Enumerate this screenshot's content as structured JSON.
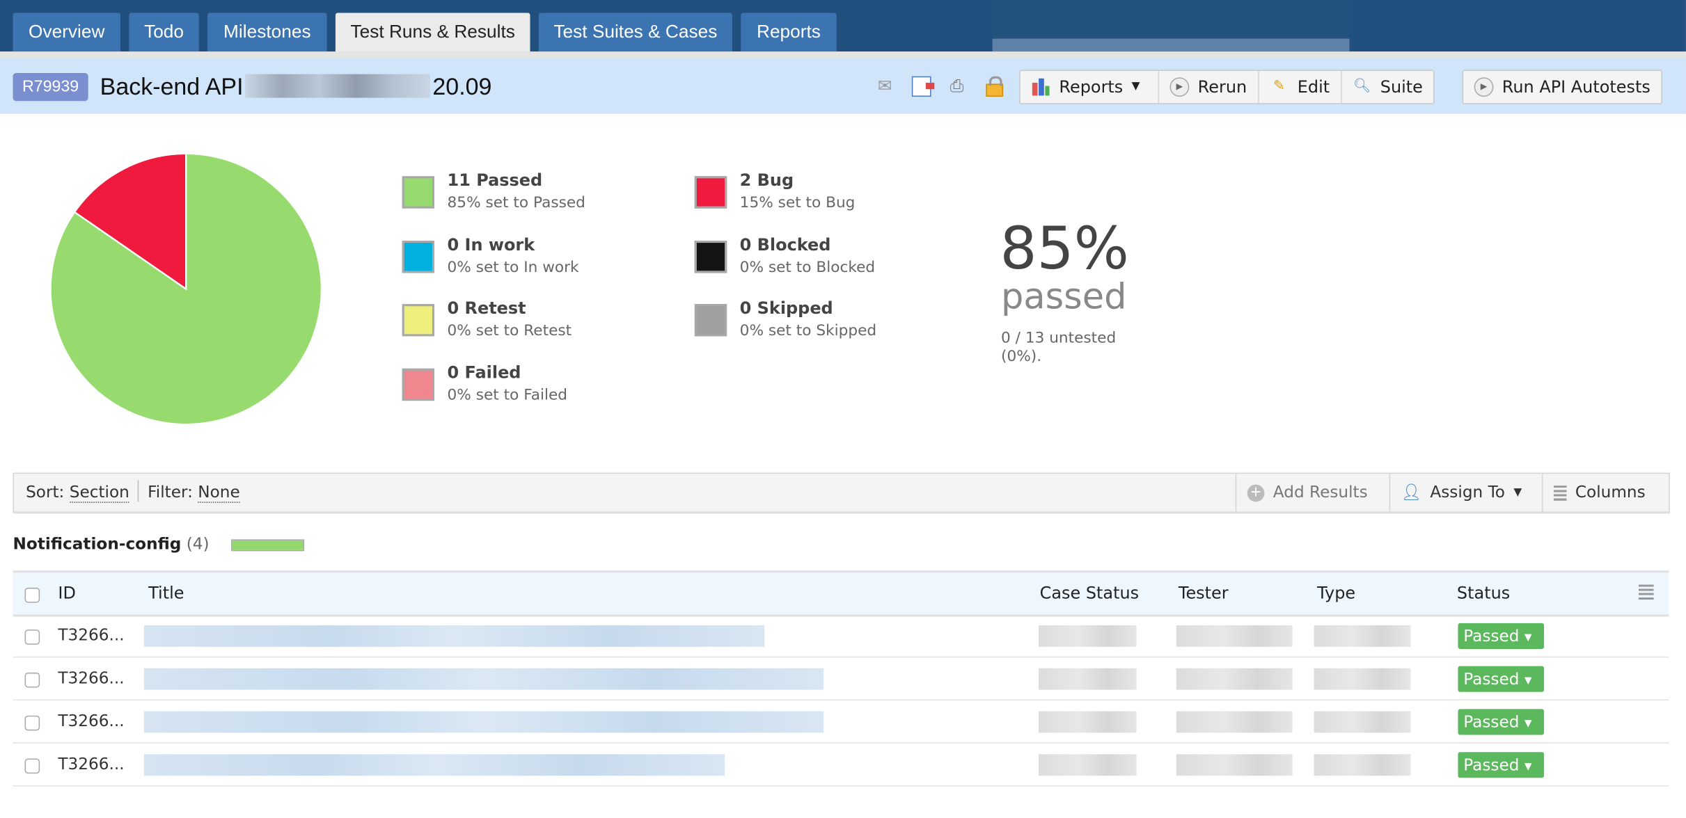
{
  "nav": {
    "tabs": [
      {
        "label": "Overview",
        "active": false
      },
      {
        "label": "Todo",
        "active": false
      },
      {
        "label": "Milestones",
        "active": false
      },
      {
        "label": "Test Runs & Results",
        "active": true
      },
      {
        "label": "Test Suites & Cases",
        "active": false
      },
      {
        "label": "Reports",
        "active": false
      }
    ]
  },
  "header": {
    "run_id": "R79939",
    "title_prefix": "Back-end API",
    "title_suffix": "20.09",
    "icons": [
      "mail-icon",
      "export-icon",
      "print-icon",
      "lock-icon"
    ],
    "buttons": {
      "reports": "Reports",
      "rerun": "Rerun",
      "edit": "Edit",
      "suite": "Suite",
      "run_autotests": "Run API Autotests"
    }
  },
  "summary": {
    "statuses": [
      {
        "count_label": "11 Passed",
        "sub": "85% set to Passed",
        "color": "#97db6f",
        "count": 11
      },
      {
        "count_label": "0 In work",
        "sub": "0% set to In work",
        "color": "#00b0de",
        "count": 0
      },
      {
        "count_label": "0 Retest",
        "sub": "0% set to Retest",
        "color": "#eef07e",
        "count": 0
      },
      {
        "count_label": "0 Failed",
        "sub": "0% set to Failed",
        "color": "#f0868e",
        "count": 0
      },
      {
        "count_label": "2 Bug",
        "sub": "15% set to Bug",
        "color": "#f01a3e",
        "count": 2
      },
      {
        "count_label": "0 Blocked",
        "sub": "0% set to Blocked",
        "color": "#141414",
        "count": 0
      },
      {
        "count_label": "0 Skipped",
        "sub": "0% set to Skipped",
        "color": "#a0a0a0",
        "count": 0
      }
    ],
    "percent": "85%",
    "percent_label": "passed",
    "untested": "0 / 13 untested (0%)."
  },
  "toolbar": {
    "sort_label": "Sort:",
    "sort_value": "Section",
    "filter_label": "Filter:",
    "filter_value": "None",
    "add_results": "Add Results",
    "assign_to": "Assign To",
    "columns": "Columns"
  },
  "section": {
    "name": "Notification-config",
    "count": "(4)",
    "passed_fraction": 1.0
  },
  "table": {
    "columns": {
      "id": "ID",
      "title": "Title",
      "case_status": "Case Status",
      "tester": "Tester",
      "type": "Type",
      "status": "Status"
    },
    "rows": [
      {
        "id": "T3266...",
        "status": "Passed"
      },
      {
        "id": "T3266...",
        "status": "Passed"
      },
      {
        "id": "T3266...",
        "status": "Passed"
      },
      {
        "id": "T3266...",
        "status": "Passed"
      }
    ]
  }
}
